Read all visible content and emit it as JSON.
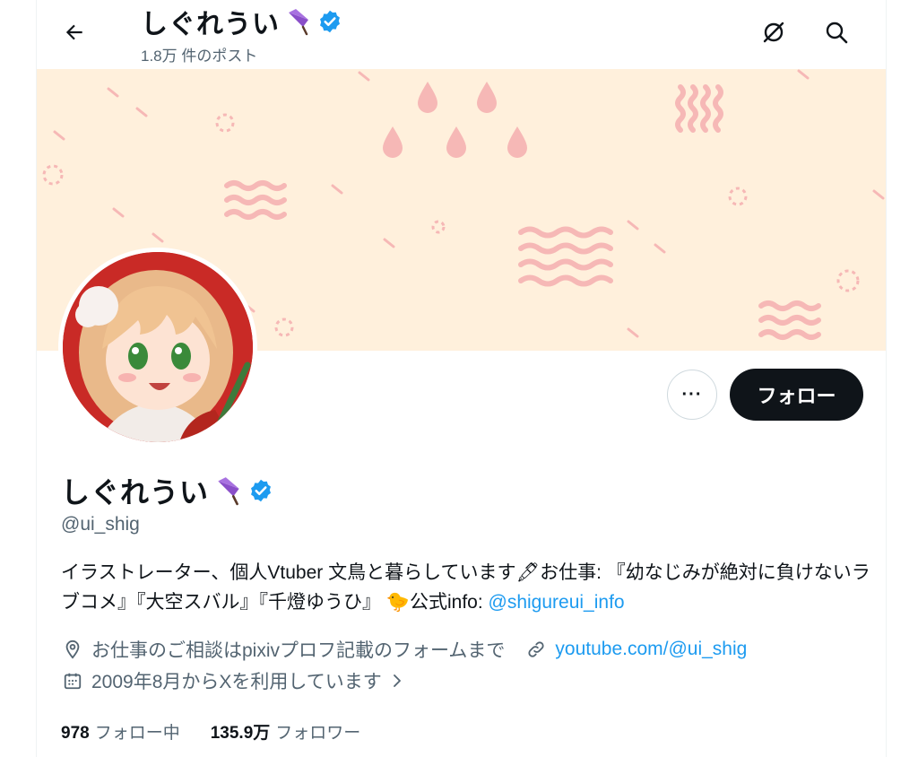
{
  "header": {
    "name": "しぐれうい",
    "posts_count": "1.8万 件のポスト"
  },
  "profile": {
    "display_name": "しぐれうい",
    "handle": "@ui_shig",
    "bio_text": "イラストレーター、個人Vtuber 文鳥と暮らしています🖋お仕事: 『幼なじみが絶対に負けないラブコメ』『大空スバル』『千燈ゆうひ』 🐤公式info: ",
    "bio_link": "@shigureui_info",
    "location": "お仕事のご相談はpixivプロフ記載のフォームまで",
    "website": "youtube.com/@ui_shig",
    "joined": "2009年8月からXを利用しています"
  },
  "actions": {
    "more_label": "···",
    "follow_label": "フォロー"
  },
  "stats": {
    "following_count": "978",
    "following_label": "フォロー中",
    "followers_count": "135.9万",
    "followers_label": "フォロワー"
  },
  "icons": {
    "back": "arrow-left-icon",
    "grok": "grok-icon",
    "search": "search-icon",
    "verified": "verified-badge-icon",
    "emoji": "umbrella-emoji-icon",
    "location": "location-pin-icon",
    "link": "link-icon",
    "calendar": "calendar-icon"
  },
  "colors": {
    "accent": "#1d9bf0",
    "text_secondary": "#536471",
    "banner_bg": "#fff0dc",
    "banner_pattern": "#f6b8b6"
  }
}
